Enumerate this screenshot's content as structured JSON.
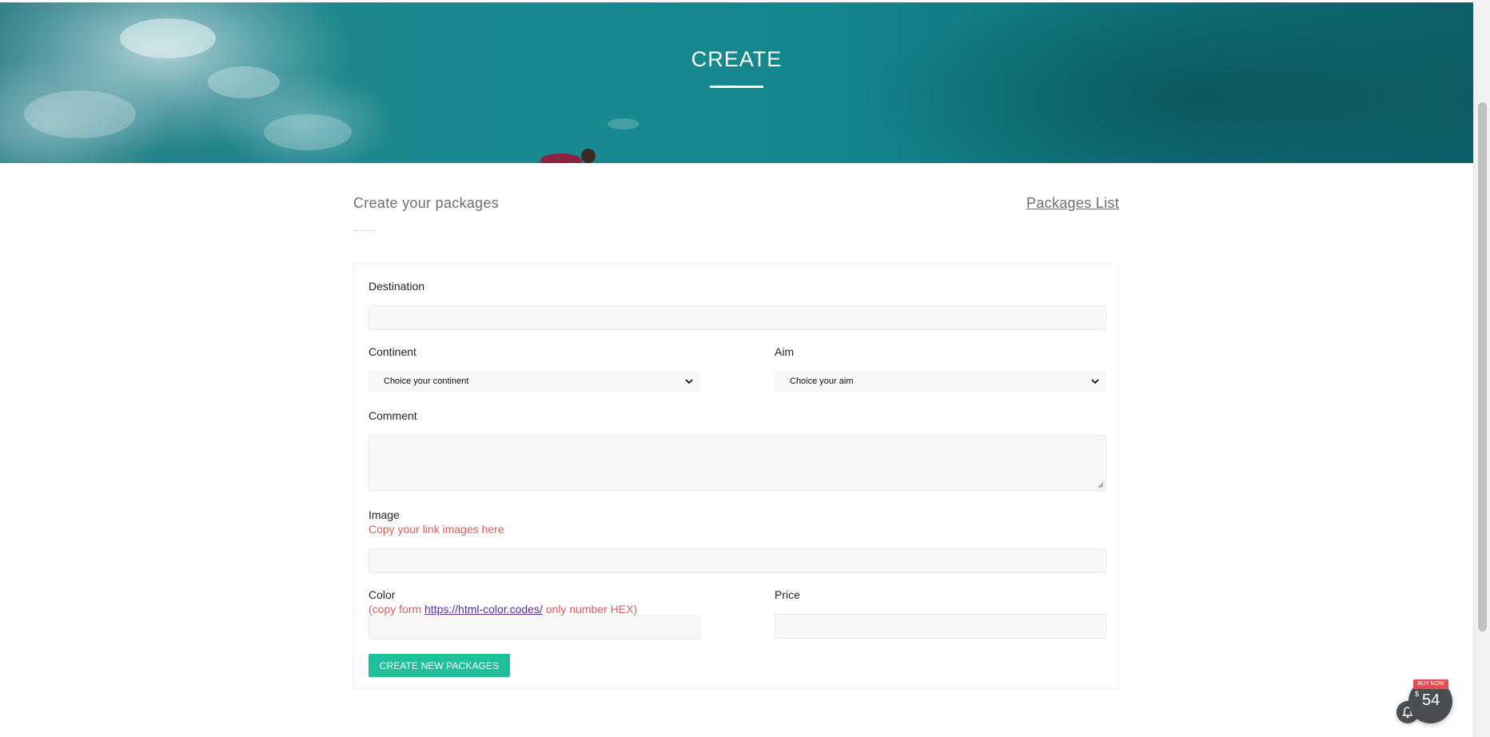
{
  "hero": {
    "title": "CREATE"
  },
  "section": {
    "title": "Create your packages",
    "packages_link": "Packages List"
  },
  "form": {
    "destination": {
      "label": "Destination",
      "value": ""
    },
    "continent": {
      "label": "Continent",
      "selected": "Choice your continent"
    },
    "aim": {
      "label": "Aim",
      "selected": "Choice your aim"
    },
    "comment": {
      "label": "Comment",
      "value": ""
    },
    "image": {
      "label": "Image",
      "hint": "Copy your link images here",
      "value": ""
    },
    "color": {
      "label": "Color",
      "hint_prefix": "(copy form ",
      "hint_link": "https://html-color.codes/",
      "hint_suffix": " only number HEX)",
      "value": ""
    },
    "price": {
      "label": "Price",
      "value": ""
    },
    "submit_label": "CREATE NEW PACKAGES"
  },
  "widget": {
    "badge": "BUY NOW",
    "currency": "$",
    "price": "54"
  },
  "colors": {
    "accent": "#1fbf9b",
    "hint": "#d06060",
    "link": "#5b2d8e",
    "widget": "#4a4d52",
    "badge": "#e94b57"
  },
  "icons": [
    "chevron-down-icon",
    "notification-bell-icon",
    "resize-grip-icon"
  ]
}
